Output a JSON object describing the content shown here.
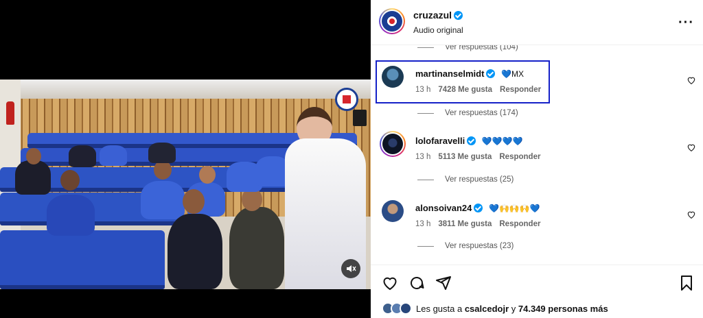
{
  "post": {
    "account": "cruzazul",
    "audio": "Audio original",
    "more_icon": "more-horizontal-icon"
  },
  "comments": [
    {
      "replies": "Ver respuestas (104)"
    },
    {
      "user": "martinanselmidt",
      "text": "💙MX",
      "time": "13 h",
      "likes": "7428 Me gusta",
      "reply": "Responder",
      "replies": "Ver respuestas (174)",
      "highlighted": true
    },
    {
      "user": "lolofaravelli",
      "text": "💙💙💙💙",
      "time": "13 h",
      "likes": "5113 Me gusta",
      "reply": "Responder",
      "replies": "Ver respuestas (25)"
    },
    {
      "user": "alonsoivan24",
      "text": "💙🙌🙌🙌💙",
      "time": "13 h",
      "likes": "3811 Me gusta",
      "reply": "Responder",
      "replies": "Ver respuestas (23)"
    }
  ],
  "footer": {
    "likes_prefix": "Les gusta a ",
    "liker": "csalcedojr",
    "likes_mid": " y ",
    "likes_count": "74.349 personas más"
  },
  "colors": {
    "highlight_box": "#1420c8",
    "verified": "#0095f6",
    "club_blue": "#1b3d93"
  }
}
